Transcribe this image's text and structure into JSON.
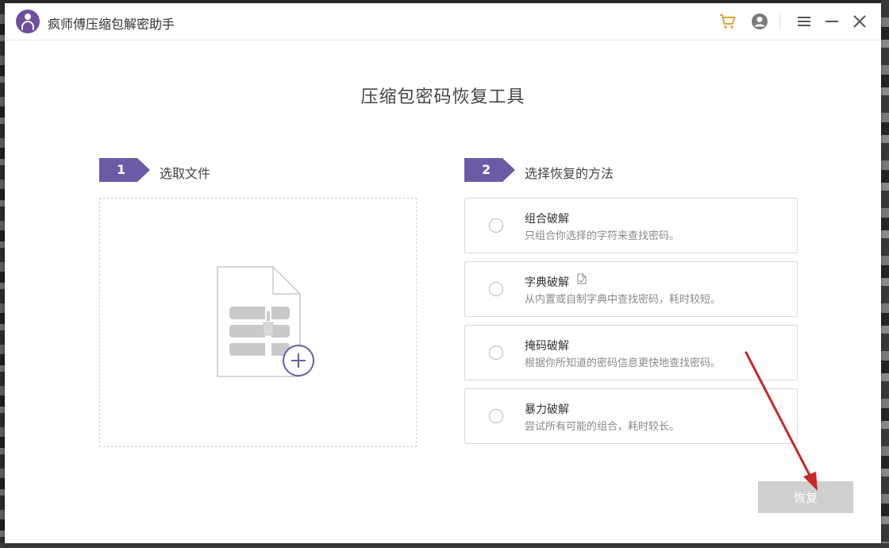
{
  "window": {
    "title": "疯师傅压缩包解密助手"
  },
  "titlebar": {
    "icons": [
      "cart-icon",
      "user-icon",
      "menu-icon",
      "minimize-icon",
      "close-icon"
    ],
    "accent_color": "#e6a23c"
  },
  "main": {
    "title": "压缩包密码恢复工具"
  },
  "step1": {
    "number": "1",
    "label": "选取文件"
  },
  "step2": {
    "number": "2",
    "label": "选择恢复的方法"
  },
  "methods": [
    {
      "name": "组合破解",
      "desc": "只组合你选择的字符来查找密码。"
    },
    {
      "name": "字典破解",
      "desc": "从内置或自制字典中查找密码，耗时较短。"
    },
    {
      "name": "掩码破解",
      "desc": "根据你所知道的密码信息更快地查找密码。"
    },
    {
      "name": "暴力破解",
      "desc": "尝试所有可能的组合，耗时较长。"
    }
  ],
  "actions": {
    "recover_label": "恢复"
  },
  "colors": {
    "brand": "#6d5aa6",
    "button_disabled": "#cfcfcf",
    "annotation_arrow": "#c62828"
  }
}
